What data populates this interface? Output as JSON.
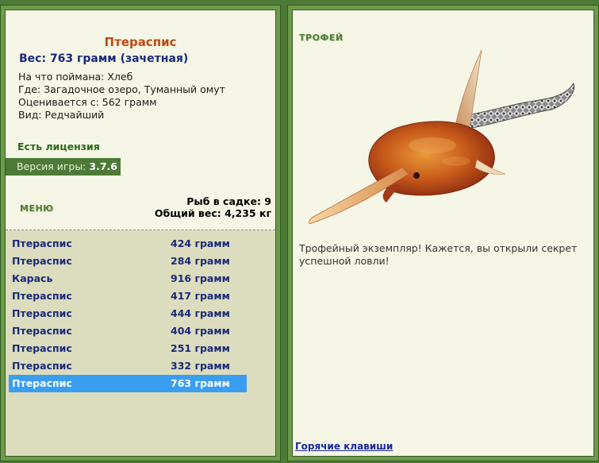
{
  "fish": {
    "name": "Птераспис",
    "weight_line": "Вес: 763 грамм (зачетная)",
    "bait": "На что поймана: Хлеб",
    "location": "Где: Загадочное озеро, Туманный омут",
    "valued": "Оценивается с: 562 грамм",
    "rarity": "Вид: Редчайший"
  },
  "license": "Есть лицензия",
  "version": {
    "label": "Версия игры:",
    "value": "3.7.6"
  },
  "menu_label": "МЕНЮ",
  "keep": {
    "count": "Рыб в садке: 9",
    "total": "Общий вес: 4,235 кг"
  },
  "catch_list": [
    {
      "name": "Птераспис",
      "weight": "424 грамм"
    },
    {
      "name": "Птераспис",
      "weight": "284 грамм"
    },
    {
      "name": "Карась",
      "weight": "916 грамм"
    },
    {
      "name": "Птераспис",
      "weight": "417 грамм"
    },
    {
      "name": "Птераспис",
      "weight": "444 грамм"
    },
    {
      "name": "Птераспис",
      "weight": "404 грамм"
    },
    {
      "name": "Птераспис",
      "weight": "251 грамм"
    },
    {
      "name": "Птераспис",
      "weight": "332 грамм"
    },
    {
      "name": "Птераспис",
      "weight": "763 грамм"
    }
  ],
  "selected_index": 8,
  "trophy": {
    "label": "ТРОФЕЙ",
    "text": "Трофейный экземпляр! Кажется, вы открыли секрет успешной ловли!"
  },
  "hotkeys_link": "Горячие клавиши",
  "colors": {
    "frame": "#4e7a38",
    "panel": "#f6f6e6",
    "selected_row": "#3a9ef0",
    "fish_name": "#c04a10",
    "list_text": "#1a2a7a"
  }
}
